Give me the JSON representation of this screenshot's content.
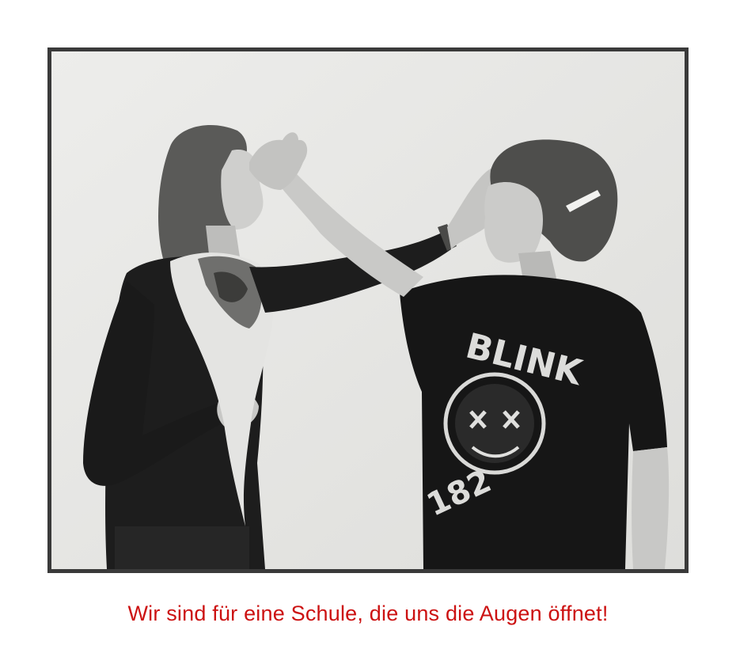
{
  "photo": {
    "style": "black-and-white",
    "frame_color": "#3a3a3a",
    "background_color": "#e9e9e7"
  },
  "shirt_print": {
    "line1": "BLINK",
    "line2": "182"
  },
  "caption": {
    "text": "Wir sind für eine Schule, die uns die Augen öffnet!",
    "color": "#cc1111"
  }
}
